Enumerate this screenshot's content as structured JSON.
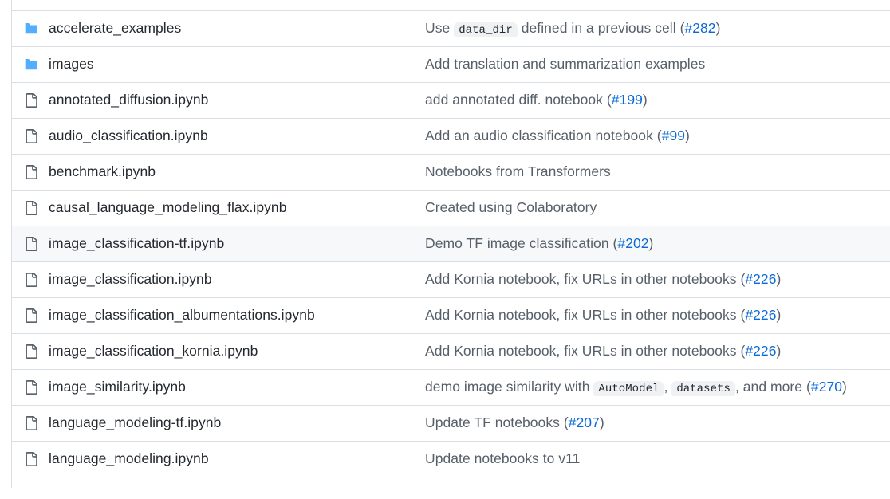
{
  "colors": {
    "folder_icon": "#54aeff",
    "file_icon": "#57606a",
    "link": "#0969da",
    "text_primary": "#24292f",
    "text_secondary": "#57606a",
    "border": "#d8dee4",
    "row_highlight": "#f6f8fa",
    "code_chip_bg": "#eff1f3",
    "background": "#ffffff"
  },
  "file_list": {
    "rows": [
      {
        "icon": "folder-icon",
        "type": "directory",
        "name": "accelerate_examples",
        "highlighted": false,
        "message_parts": [
          {
            "kind": "text",
            "text": "Use "
          },
          {
            "kind": "code",
            "text": "data_dir"
          },
          {
            "kind": "text",
            "text": " defined in a previous cell "
          },
          {
            "kind": "paren",
            "text": "("
          },
          {
            "kind": "link",
            "text": "#282"
          },
          {
            "kind": "paren",
            "text": ")"
          }
        ]
      },
      {
        "icon": "folder-icon",
        "type": "directory",
        "name": "images",
        "highlighted": false,
        "message_parts": [
          {
            "kind": "text",
            "text": "Add translation and summarization examples"
          }
        ]
      },
      {
        "icon": "file-icon",
        "type": "file",
        "name": "annotated_diffusion.ipynb",
        "highlighted": false,
        "message_parts": [
          {
            "kind": "text",
            "text": "add annotated diff. notebook "
          },
          {
            "kind": "paren",
            "text": "("
          },
          {
            "kind": "link",
            "text": "#199"
          },
          {
            "kind": "paren",
            "text": ")"
          }
        ]
      },
      {
        "icon": "file-icon",
        "type": "file",
        "name": "audio_classification.ipynb",
        "highlighted": false,
        "message_parts": [
          {
            "kind": "text",
            "text": "Add an audio classification notebook "
          },
          {
            "kind": "paren",
            "text": "("
          },
          {
            "kind": "link",
            "text": "#99"
          },
          {
            "kind": "paren",
            "text": ")"
          }
        ]
      },
      {
        "icon": "file-icon",
        "type": "file",
        "name": "benchmark.ipynb",
        "highlighted": false,
        "message_parts": [
          {
            "kind": "text",
            "text": "Notebooks from Transformers"
          }
        ]
      },
      {
        "icon": "file-icon",
        "type": "file",
        "name": "causal_language_modeling_flax.ipynb",
        "highlighted": false,
        "message_parts": [
          {
            "kind": "text",
            "text": "Created using Colaboratory"
          }
        ]
      },
      {
        "icon": "file-icon",
        "type": "file",
        "name": "image_classification-tf.ipynb",
        "highlighted": true,
        "message_parts": [
          {
            "kind": "text",
            "text": "Demo TF image classification "
          },
          {
            "kind": "paren",
            "text": "("
          },
          {
            "kind": "link",
            "text": "#202"
          },
          {
            "kind": "paren",
            "text": ")"
          }
        ]
      },
      {
        "icon": "file-icon",
        "type": "file",
        "name": "image_classification.ipynb",
        "highlighted": false,
        "message_parts": [
          {
            "kind": "text",
            "text": "Add Kornia notebook, fix URLs in other notebooks "
          },
          {
            "kind": "paren",
            "text": "("
          },
          {
            "kind": "link",
            "text": "#226"
          },
          {
            "kind": "paren",
            "text": ")"
          }
        ]
      },
      {
        "icon": "file-icon",
        "type": "file",
        "name": "image_classification_albumentations.ipynb",
        "highlighted": false,
        "message_parts": [
          {
            "kind": "text",
            "text": "Add Kornia notebook, fix URLs in other notebooks "
          },
          {
            "kind": "paren",
            "text": "("
          },
          {
            "kind": "link",
            "text": "#226"
          },
          {
            "kind": "paren",
            "text": ")"
          }
        ]
      },
      {
        "icon": "file-icon",
        "type": "file",
        "name": "image_classification_kornia.ipynb",
        "highlighted": false,
        "message_parts": [
          {
            "kind": "text",
            "text": "Add Kornia notebook, fix URLs in other notebooks "
          },
          {
            "kind": "paren",
            "text": "("
          },
          {
            "kind": "link",
            "text": "#226"
          },
          {
            "kind": "paren",
            "text": ")"
          }
        ]
      },
      {
        "icon": "file-icon",
        "type": "file",
        "name": "image_similarity.ipynb",
        "highlighted": false,
        "message_parts": [
          {
            "kind": "text",
            "text": "demo image similarity with "
          },
          {
            "kind": "code",
            "text": "AutoModel"
          },
          {
            "kind": "text",
            "text": ", "
          },
          {
            "kind": "code",
            "text": "datasets"
          },
          {
            "kind": "text",
            "text": ", and more "
          },
          {
            "kind": "paren",
            "text": "("
          },
          {
            "kind": "link",
            "text": "#270"
          },
          {
            "kind": "paren",
            "text": ")"
          }
        ]
      },
      {
        "icon": "file-icon",
        "type": "file",
        "name": "language_modeling-tf.ipynb",
        "highlighted": false,
        "message_parts": [
          {
            "kind": "text",
            "text": "Update TF notebooks "
          },
          {
            "kind": "paren",
            "text": "("
          },
          {
            "kind": "link",
            "text": "#207"
          },
          {
            "kind": "paren",
            "text": ")"
          }
        ]
      },
      {
        "icon": "file-icon",
        "type": "file",
        "name": "language_modeling.ipynb",
        "highlighted": false,
        "message_parts": [
          {
            "kind": "text",
            "text": "Update notebooks to v11"
          }
        ]
      }
    ]
  }
}
